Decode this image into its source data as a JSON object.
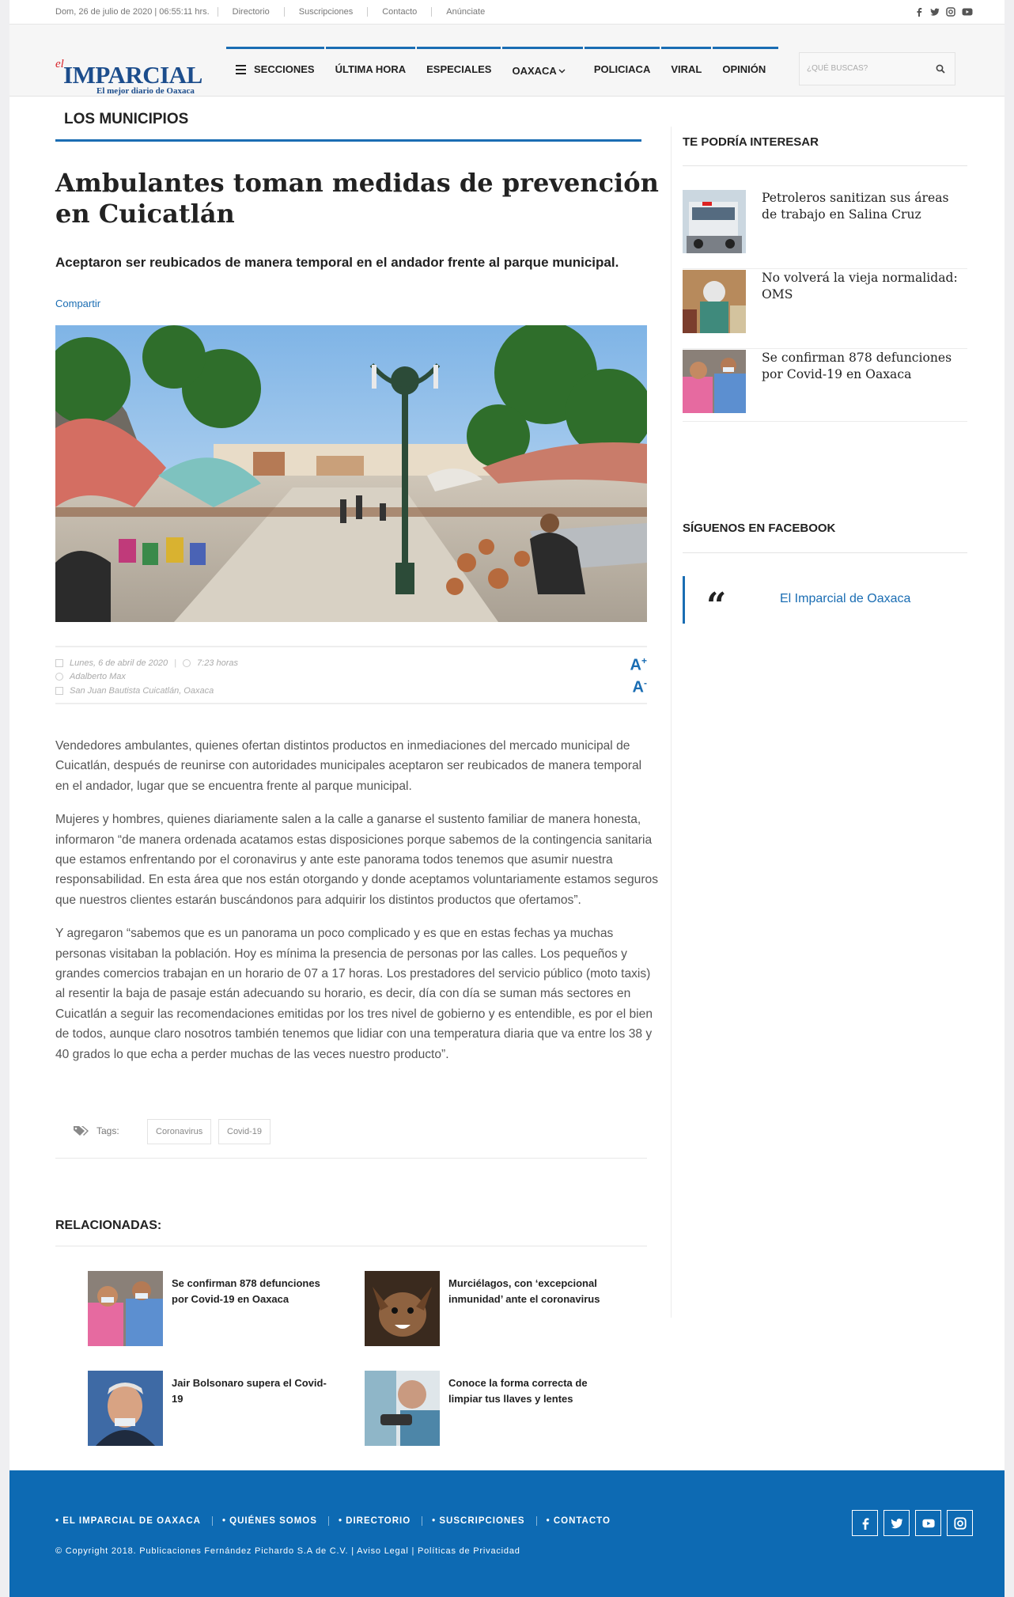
{
  "topbar": {
    "date": "Dom, 26 de julio de 2020 | 06:55:11 hrs.",
    "links": [
      "Directorio",
      "Suscripciones",
      "Contacto",
      "Anúnciate"
    ]
  },
  "header": {
    "logo_el": "el",
    "logo_name": "IMPARCIAL",
    "logo_tagline": "El mejor diario de Oaxaca",
    "nav": [
      "SECCIONES",
      "ÚLTIMA HORA",
      "ESPECIALES",
      "OAXACA",
      "POLICIACA",
      "VIRAL",
      "OPINIÓN"
    ],
    "search_placeholder": "¿QUÉ BUSCAS?"
  },
  "article": {
    "section": "LOS MUNICIPIOS",
    "title": "Ambulantes toman medidas de prevención en Cuicatlán",
    "subtitle": "Aceptaron ser reubicados de manera temporal en el andador frente al parque municipal.",
    "share": "Compartir",
    "date": "Lunes, 6 de abril de 2020",
    "time": "7:23 horas",
    "author": "Adalberto Max",
    "location": "San Juan Bautista Cuicatlán, Oaxaca",
    "font_up": "A",
    "font_up_sup": "+",
    "font_down": "A",
    "font_down_sup": "-",
    "paragraphs": [
      "Vendedores ambulantes, quienes ofertan distintos productos en inmediaciones del mercado municipal de Cuicatlán, después de reunirse con autoridades municipales aceptaron ser reubicados de manera temporal en el andador, lugar que se encuentra frente al parque municipal.",
      "Mujeres y hombres, quienes diariamente salen a la calle a ganarse el sustento familiar de manera honesta, informaron “de manera ordenada acatamos estas disposiciones porque sabemos de la contingencia sanitaria que estamos enfrentando por el coronavirus y ante este panorama todos tenemos que asumir nuestra responsabilidad. En esta área que nos están otorgando y donde aceptamos voluntariamente estamos seguros que nuestros clientes estarán buscándonos para adquirir los distintos productos que ofertamos”.",
      "Y agregaron “sabemos que es un panorama un poco complicado y es que en estas fechas ya muchas personas visitaban la población. Hoy es mínima la presencia de personas por las calles. Los pequeños y grandes comercios trabajan en un horario de 07 a 17 horas. Los prestadores del servicio público (moto taxis) al resentir la baja de pasaje están adecuando su horario, es decir, día con día se suman más sectores en Cuicatlán a seguir las recomendaciones emitidas por los tres nivel de gobierno y es entendible, es por el bien de todos, aunque claro nosotros también tenemos que lidiar con una temperatura diaria que va entre los 38 y 40 grados lo que echa a perder muchas de las veces nuestro producto”."
    ],
    "tags_label": "Tags:",
    "tags": [
      "Coronavirus",
      "Covid-19"
    ]
  },
  "related": {
    "title": "RELACIONADAS:",
    "items": [
      "Se confirman 878 defunciones por Covid-19 en Oaxaca",
      "Murciélagos, con ‘excepcional inmunidad’ ante el coronavirus",
      "Jair Bolsonaro supera el Covid-19",
      "Conoce la forma correcta de limpiar tus llaves y lentes"
    ]
  },
  "sidebar": {
    "interest_title": "TE PODRÍA INTERESAR",
    "interest_items": [
      "Petroleros sanitizan sus áreas de trabajo en Salina Cruz",
      "No volverá la vieja normalidad: OMS",
      "Se confirman 878 defunciones por Covid-19 en Oaxaca"
    ],
    "facebook_title": "SÍGUENOS EN FACEBOOK",
    "facebook_quote": "“",
    "facebook_link": "El Imparcial de Oaxaca"
  },
  "footer": {
    "nav": [
      "• EL IMPARCIAL DE OAXACA",
      "• QUIÉNES SOMOS",
      "• DIRECTORIO",
      "• SUSCRIPCIONES",
      "• CONTACTO"
    ],
    "copyright": "© Copyright 2018. Publicaciones Fernández Pichardo S.A de C.V. | Aviso Legal | Políticas de Privacidad"
  },
  "colors": {
    "accent": "#1a6db3",
    "brand_red": "#d8232a",
    "footer": "#0d6ab3"
  },
  "icons": [
    "facebook-icon",
    "twitter-icon",
    "instagram-icon",
    "youtube-icon",
    "search-icon",
    "menu-icon",
    "chevron-down-icon",
    "calendar-icon",
    "clock-icon",
    "user-icon",
    "map-icon",
    "tags-icon",
    "quote-icon"
  ]
}
